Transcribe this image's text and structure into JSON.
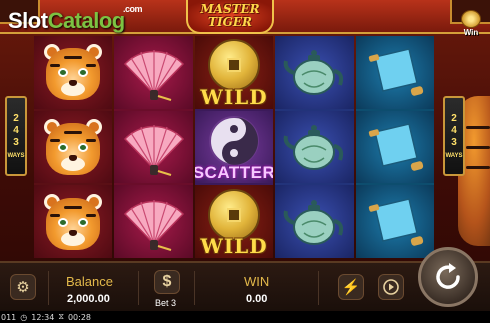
{
  "watermark": {
    "part1": "Slot",
    "part2": "Catalog",
    "suffix": ".com"
  },
  "game": {
    "logo_line1": "MASTER",
    "logo_line2": "TIGER"
  },
  "win_badge": {
    "label": "Win"
  },
  "ways": {
    "count": [
      "2",
      "4",
      "3"
    ],
    "label": "WAYS"
  },
  "reels": [
    {
      "symbols": [
        "tiger",
        "tiger",
        "tiger"
      ]
    },
    {
      "symbols": [
        "fan",
        "fan",
        "fan"
      ]
    },
    {
      "symbols": [
        "wild",
        "scatter",
        "wild"
      ]
    },
    {
      "symbols": [
        "teapot",
        "teapot",
        "teapot"
      ]
    },
    {
      "symbols": [
        "scroll",
        "scroll",
        "scroll"
      ]
    }
  ],
  "symbol_text": {
    "wild": "WILD",
    "scatter": "SCATTER"
  },
  "controls": {
    "balance_label": "Balance",
    "balance_value": "2,000.00",
    "bet_label": "Bet",
    "bet_value": "3",
    "win_label": "WIN",
    "win_value": "0.00",
    "bet_icon": "$"
  },
  "icons": {
    "settings": "gear-icon",
    "bet": "dollar-icon",
    "turbo": "lightning-icon",
    "autoplay": "autoplay-icon",
    "spin": "spin-arrow-icon"
  },
  "status": {
    "id": "011",
    "clock": "12:34",
    "timer": "00:28"
  },
  "colors": {
    "gold": "#e2b84a",
    "wild_text": "#ffdc4a",
    "scatter_text": "#f7c8ff"
  }
}
